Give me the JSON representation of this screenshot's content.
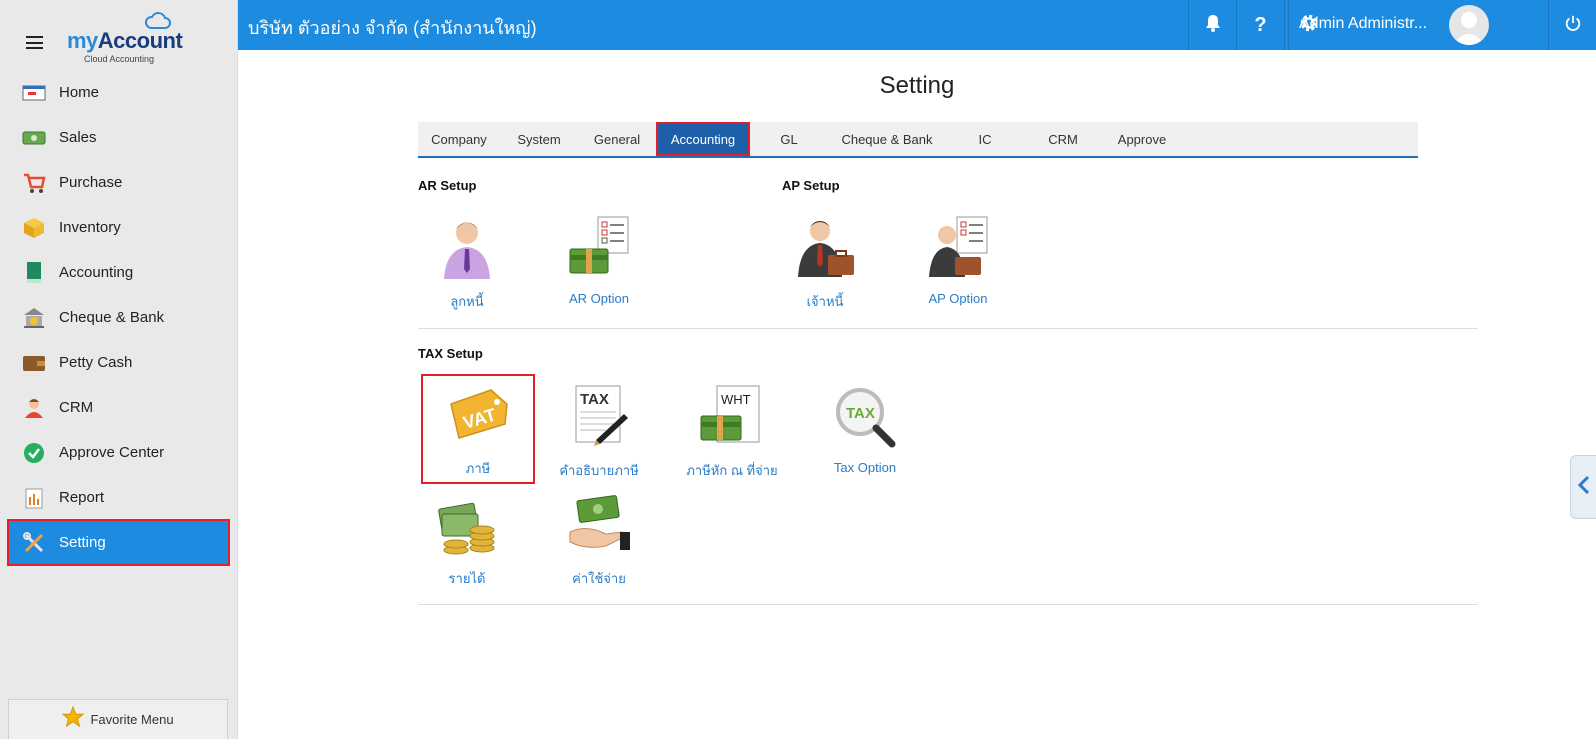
{
  "brand": {
    "my": "my",
    "account": "Account",
    "tagline": "Cloud Accounting"
  },
  "sidebar": {
    "items": [
      {
        "label": "Home",
        "icon": "home-icon"
      },
      {
        "label": "Sales",
        "icon": "sales-icon"
      },
      {
        "label": "Purchase",
        "icon": "cart-icon"
      },
      {
        "label": "Inventory",
        "icon": "box-icon"
      },
      {
        "label": "Accounting",
        "icon": "book-icon"
      },
      {
        "label": "Cheque & Bank",
        "icon": "bank-icon"
      },
      {
        "label": "Petty Cash",
        "icon": "wallet-icon"
      },
      {
        "label": "CRM",
        "icon": "people-icon"
      },
      {
        "label": "Approve Center",
        "icon": "check-circle-icon"
      },
      {
        "label": "Report",
        "icon": "report-icon"
      },
      {
        "label": "Setting",
        "icon": "tools-icon",
        "active": true
      }
    ],
    "favorite_label": "Favorite Menu"
  },
  "topbar": {
    "company": "บริษัท ตัวอย่าง จำกัด (สำนักงานใหญ่)",
    "user_name": "Admin Administr...",
    "help_label": "?"
  },
  "page": {
    "title": "Setting",
    "tabs": [
      "Company",
      "System",
      "General",
      "Accounting",
      "GL",
      "Cheque & Bank",
      "IC",
      "CRM",
      "Approve"
    ],
    "active_tab": "Accounting"
  },
  "ar_setup": {
    "title": "AR Setup",
    "items": [
      {
        "label": "ลูกหนี้",
        "icon": "debtor-person-icon"
      },
      {
        "label": "AR Option",
        "icon": "ar-option-icon"
      }
    ]
  },
  "ap_setup": {
    "title": "AP Setup",
    "items": [
      {
        "label": "เจ้าหนี้",
        "icon": "creditor-businessman-icon"
      },
      {
        "label": "AP Option",
        "icon": "ap-option-icon"
      }
    ]
  },
  "tax_setup": {
    "title": "TAX Setup",
    "items": [
      {
        "label": "ภาษี",
        "icon": "vat-tag-icon",
        "icon_text": "VAT"
      },
      {
        "label": "คำอธิบายภาษี",
        "icon": "tax-document-icon",
        "icon_text": "TAX"
      },
      {
        "label": "ภาษีหัก ณ ที่จ่าย",
        "icon": "wht-document-icon",
        "icon_text": "WHT"
      },
      {
        "label": "Tax Option",
        "icon": "tax-magnifier-icon",
        "icon_text": "TAX"
      },
      {
        "label": "รายได้",
        "icon": "income-money-icon"
      },
      {
        "label": "ค่าใช้จ่าย",
        "icon": "expense-hand-money-icon"
      }
    ]
  },
  "colors": {
    "primary": "#1d8ce0",
    "highlight": "#e41f2a",
    "link": "#2a7bc8",
    "active_tab": "#1d5fa8"
  }
}
